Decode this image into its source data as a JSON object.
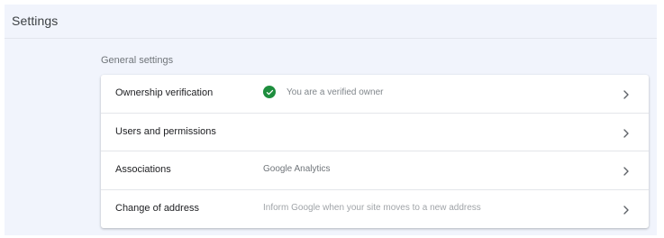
{
  "header": {
    "title": "Settings"
  },
  "general": {
    "section_label": "General settings",
    "rows": [
      {
        "label": "Ownership verification",
        "value": "You are a verified owner"
      },
      {
        "label": "Users and permissions",
        "value": ""
      },
      {
        "label": "Associations",
        "value": "Google Analytics"
      },
      {
        "label": "Change of address",
        "value": "Inform Google when your site moves to a new address"
      }
    ]
  },
  "colors": {
    "verified_check": "#1e8e3e",
    "page_background": "#f1f4fc"
  },
  "icons": {
    "verified": "check-circle-icon",
    "row_arrow": "chevron-right-icon"
  }
}
